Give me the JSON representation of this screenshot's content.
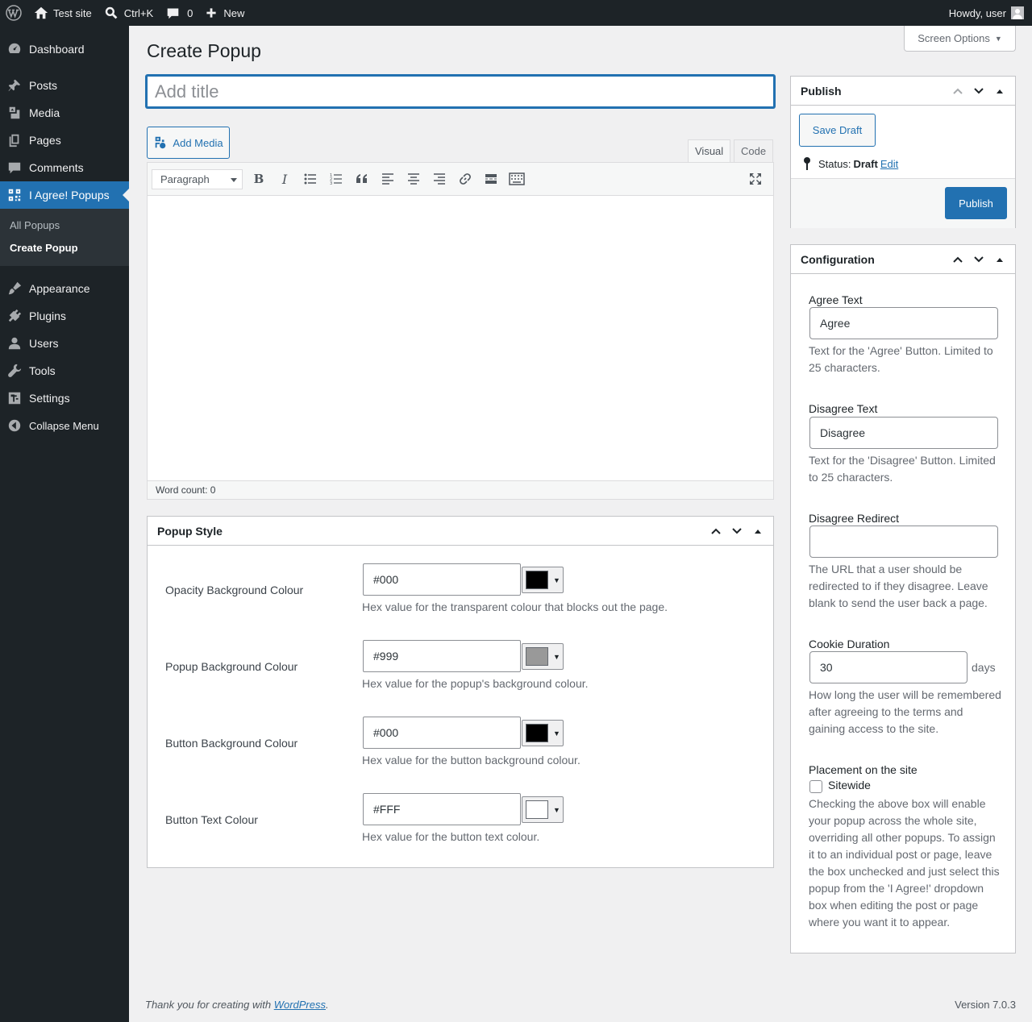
{
  "admin_bar": {
    "site_name": "Test site",
    "search_shortcut": "Ctrl+K",
    "comments_count": "0",
    "new_label": "New",
    "howdy": "Howdy, user"
  },
  "sidebar": {
    "items": [
      {
        "label": "Dashboard",
        "icon": "dashboard-icon"
      },
      {
        "label": "Posts",
        "icon": "pin-icon"
      },
      {
        "label": "Media",
        "icon": "media-icon"
      },
      {
        "label": "Pages",
        "icon": "pages-icon"
      },
      {
        "label": "Comments",
        "icon": "comment-icon"
      },
      {
        "label": "I Agree! Popups",
        "icon": "popup-icon"
      },
      {
        "label": "Appearance",
        "icon": "brush-icon"
      },
      {
        "label": "Plugins",
        "icon": "plug-icon"
      },
      {
        "label": "Users",
        "icon": "user-icon"
      },
      {
        "label": "Tools",
        "icon": "wrench-icon"
      },
      {
        "label": "Settings",
        "icon": "settings-icon"
      },
      {
        "label": "Collapse Menu",
        "icon": "collapse-icon"
      }
    ],
    "submenu": [
      "All Popups",
      "Create Popup"
    ]
  },
  "page": {
    "heading": "Create Popup",
    "screen_options": "Screen Options",
    "title_placeholder": "Add title"
  },
  "editor": {
    "add_media": "Add Media",
    "tab_visual": "Visual",
    "tab_code": "Code",
    "format": "Paragraph",
    "word_count": "Word count: 0"
  },
  "publish": {
    "title": "Publish",
    "save_draft": "Save Draft",
    "status_label": "Status:",
    "status_value": "Draft",
    "edit_link": "Edit",
    "publish_button": "Publish"
  },
  "configuration": {
    "title": "Configuration",
    "agree_label": "Agree Text",
    "agree_value": "Agree",
    "agree_desc": "Text for the 'Agree' Button. Limited to 25 characters.",
    "disagree_label": "Disagree Text",
    "disagree_value": "Disagree",
    "disagree_desc": "Text for the 'Disagree' Button. Limited to 25 characters.",
    "redirect_label": "Disagree Redirect",
    "redirect_value": "",
    "redirect_desc": "The URL that a user should be redirected to if they disagree. Leave blank to send the user back a page.",
    "cookie_label": "Cookie Duration",
    "cookie_value": "30",
    "cookie_unit": "days",
    "cookie_desc": "How long the user will be remembered after agreeing to the terms and gaining access to the site.",
    "placement_label": "Placement on the site",
    "sitewide_label": "Sitewide",
    "sitewide_checked": false,
    "placement_desc": "Checking the above box will enable your popup across the whole site, overriding all other popups. To assign it to an individual post or page, leave the box unchecked and just select this popup from the 'I Agree!' dropdown box when editing the post or page where you want it to appear."
  },
  "popup_style": {
    "title": "Popup Style",
    "rows": [
      {
        "label": "Opacity Background Colour",
        "value": "#000",
        "color": "#000000",
        "desc": "Hex value for the transparent colour that blocks out the page."
      },
      {
        "label": "Popup Background Colour",
        "value": "#999",
        "color": "#999999",
        "desc": "Hex value for the popup's background colour."
      },
      {
        "label": "Button Background Colour",
        "value": "#000",
        "color": "#000000",
        "desc": "Hex value for the button background colour."
      },
      {
        "label": "Button Text Colour",
        "value": "#FFF",
        "color": "#ffffff",
        "desc": "Hex value for the button text colour."
      }
    ]
  },
  "footer": {
    "thanks_prefix": "Thank you for creating with ",
    "wordpress_link": "WordPress",
    "thanks_suffix": ".",
    "version": "Version 7.0.3"
  }
}
